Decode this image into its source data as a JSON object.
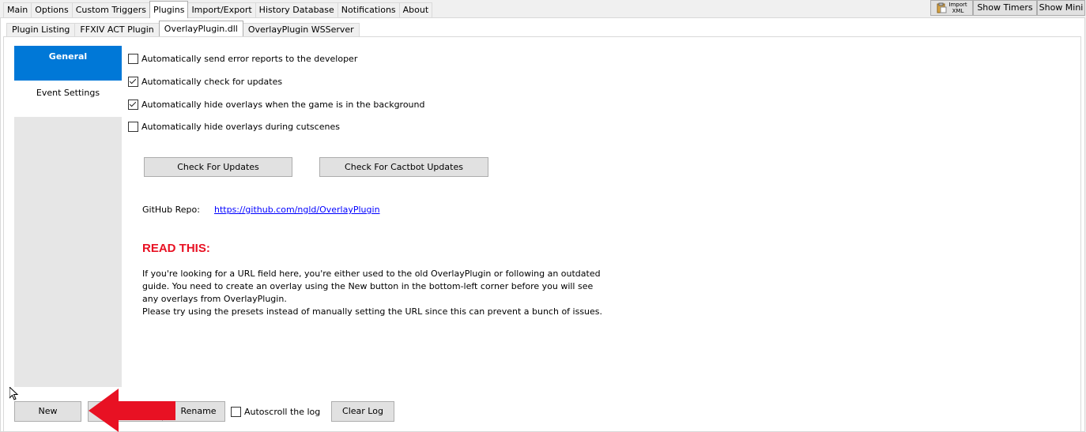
{
  "main_tabs": [
    "Main",
    "Options",
    "Custom Triggers",
    "Plugins",
    "Import/Export",
    "History Database",
    "Notifications",
    "About"
  ],
  "main_tabs_active": "Plugins",
  "toolbar": {
    "import_xml_line1": "Import",
    "import_xml_line2": "XML",
    "show_timers": "Show Timers",
    "show_mini": "Show Mini"
  },
  "plugin_tabs": [
    "Plugin Listing",
    "FFXIV ACT Plugin",
    "OverlayPlugin.dll",
    "OverlayPlugin WSServer"
  ],
  "plugin_tabs_active": "OverlayPlugin.dll",
  "sidebar": {
    "items": [
      {
        "label": "General",
        "selected": true
      },
      {
        "label": "Event Settings",
        "selected": false
      }
    ]
  },
  "general": {
    "checkboxes": [
      {
        "label": "Automatically send error reports to the developer",
        "checked": false
      },
      {
        "label": "Automatically check for updates",
        "checked": true
      },
      {
        "label": "Automatically hide overlays when the game is in the background",
        "checked": true
      },
      {
        "label": "Automatically hide overlays during cutscenes",
        "checked": false
      }
    ],
    "check_updates_button": "Check For Updates",
    "check_cactbot_button": "Check For Cactbot Updates",
    "github_label": "GitHub Repo:",
    "github_link": "https://github.com/ngld/OverlayPlugin",
    "read_this": "READ THIS:",
    "notice_lines": [
      "If you're looking for a URL field here, you're either used to the old OverlayPlugin or following an outdated",
      "guide. You need to create an overlay using the New button in the bottom-left corner before you will see",
      "any overlays from OverlayPlugin.",
      "Please try using the presets instead of manually setting the URL since this can prevent a bunch of issues."
    ]
  },
  "bottom": {
    "new": "New",
    "rename": "Rename",
    "autoscroll": "Autoscroll the log",
    "autoscroll_checked": false,
    "clear_log": "Clear Log"
  },
  "colors": {
    "selected_nav": "#0078d7",
    "read_this": "#e81123",
    "arrow": "#e81123",
    "link": "#0000ff"
  }
}
